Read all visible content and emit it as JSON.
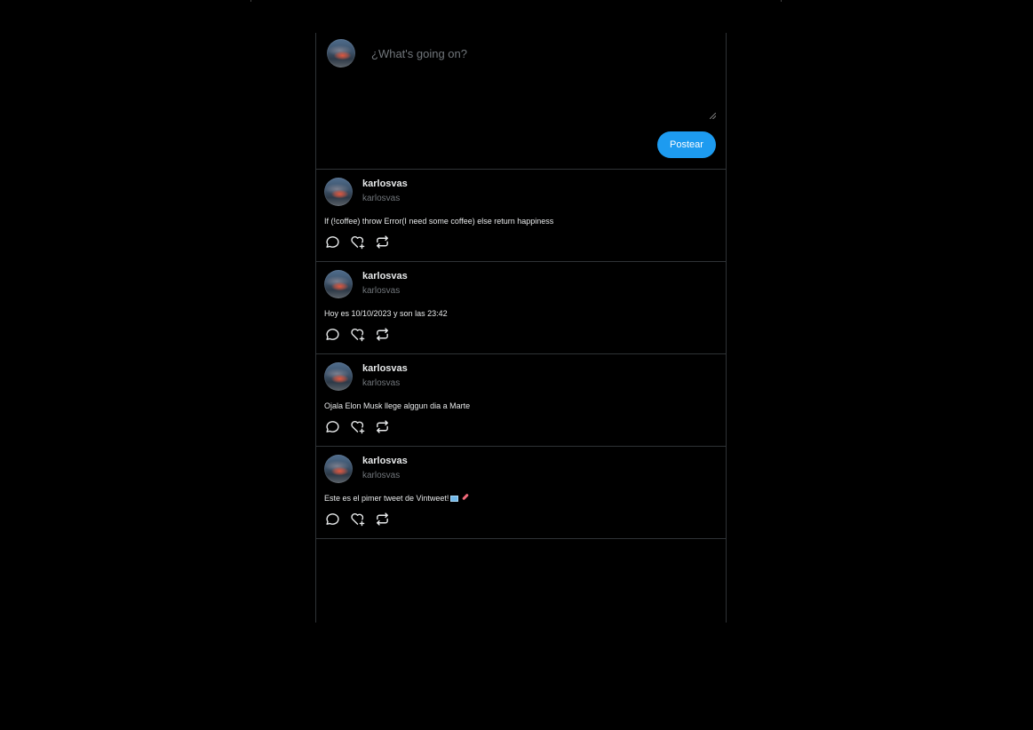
{
  "composer": {
    "placeholder": "¿What's going on?",
    "post_label": "Postear"
  },
  "tweets": [
    {
      "display_name": "karlosvas",
      "handle": "karlosvas",
      "text": "If (!coffee) throw Error(I need some coffee) else return happiness"
    },
    {
      "display_name": "karlosvas",
      "handle": "karlosvas",
      "text": "Hoy es 10/10/2023 y son las 23:42"
    },
    {
      "display_name": "karlosvas",
      "handle": "karlosvas",
      "text": "Ojala Elon Musk llege alggun dia a Marte"
    },
    {
      "display_name": "karlosvas",
      "handle": "karlosvas",
      "text": "Este es el pimer tweet de Vintweet!"
    }
  ],
  "icons": {
    "reply": "comment-icon",
    "like": "heart-plus-icon",
    "retweet": "retweet-icon",
    "emoji_1": "computer-emoji",
    "emoji_2": "rocket-emoji"
  },
  "colors": {
    "background": "#000000",
    "accent": "#1d9bf0",
    "border": "#2f3336",
    "text_primary": "#e7e9ea",
    "text_secondary": "#71767b"
  }
}
